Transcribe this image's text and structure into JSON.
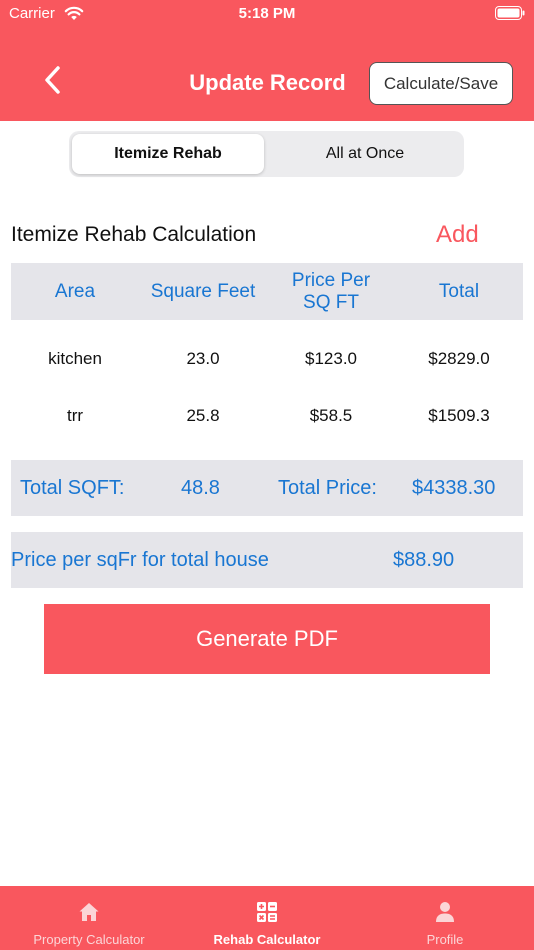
{
  "status_bar": {
    "carrier": "Carrier",
    "time": "5:18 PM"
  },
  "nav": {
    "title": "Update Record",
    "calc_save_label": "Calculate/Save"
  },
  "segments": [
    {
      "label": "Itemize Rehab",
      "selected": true
    },
    {
      "label": "All at Once",
      "selected": false
    }
  ],
  "section": {
    "title": "Itemize Rehab Calculation",
    "add_label": "Add"
  },
  "table": {
    "headers": [
      "Area",
      "Square Feet",
      "Price Per SQ FT",
      "Total"
    ],
    "rows": [
      [
        "kitchen",
        "23.0",
        "$123.0",
        "$2829.0"
      ],
      [
        "trr",
        "25.8",
        "$58.5",
        "$1509.3"
      ]
    ]
  },
  "totals": {
    "sqft_label": "Total SQFT:",
    "sqft_value": "48.8",
    "price_label": "Total Price:",
    "price_value": "$4338.30"
  },
  "price_per_sqft": {
    "label": "Price per sqFr for total house",
    "value": "$88.90"
  },
  "pdf_button_label": "Generate PDF",
  "tabs": [
    {
      "label": "Property Calculator",
      "icon": "home-icon",
      "active": false
    },
    {
      "label": "Rehab Calculator",
      "icon": "calculator-icon",
      "active": true
    },
    {
      "label": "Profile",
      "icon": "person-icon",
      "active": false
    }
  ],
  "colors": {
    "accent": "#f9575e",
    "header_text": "#ffffff",
    "table_text": "#1976d2",
    "table_bg": "#e5e5ea"
  }
}
